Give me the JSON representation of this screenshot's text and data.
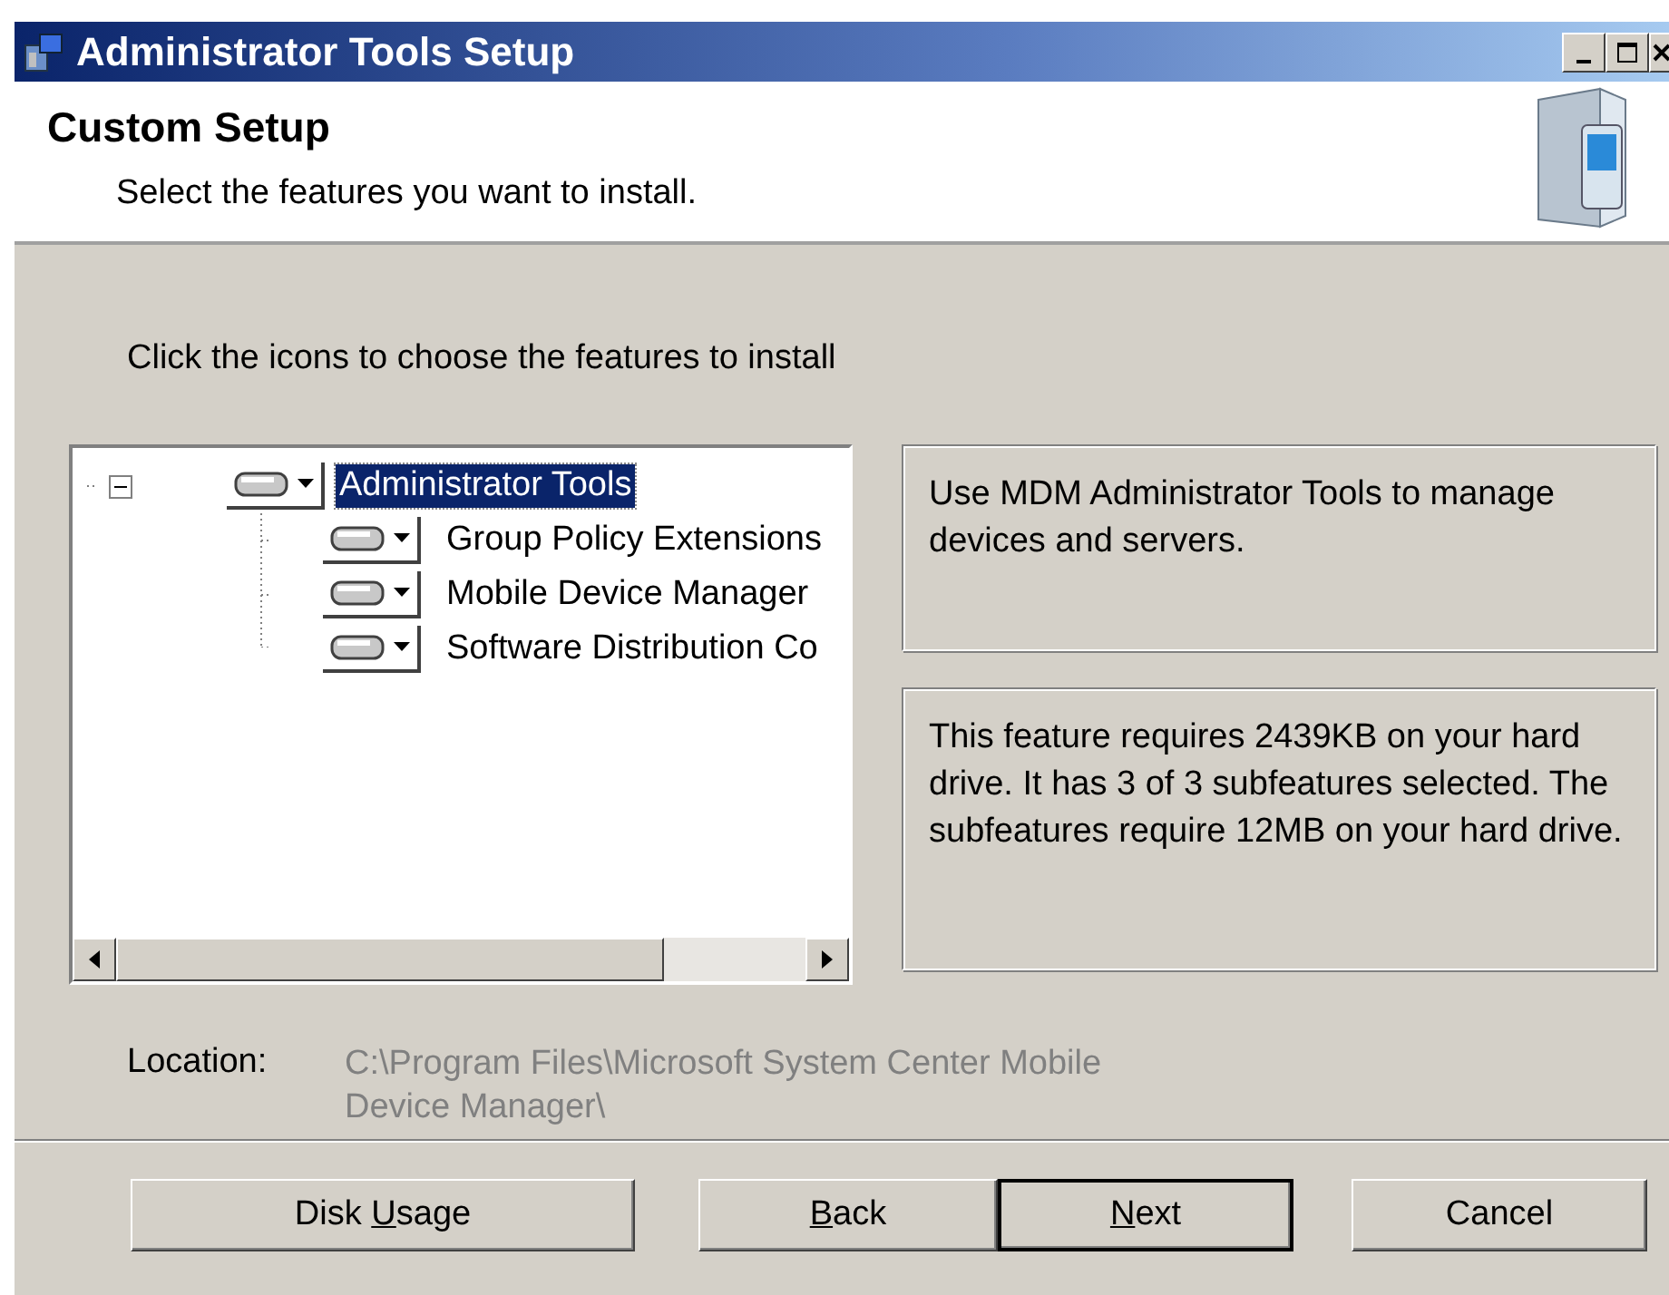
{
  "window": {
    "title": "Administrator Tools Setup"
  },
  "header": {
    "title": "Custom Setup",
    "subtitle": "Select the features you want to install."
  },
  "instruction": "Click the icons to choose the features to install",
  "tree": [
    {
      "label": "Administrator Tools",
      "selected": true,
      "expanded": true,
      "children": [
        {
          "label": "Group Policy Extensions",
          "selected": false
        },
        {
          "label": "Mobile Device Manager",
          "selected": false
        },
        {
          "label": "Software Distribution Co",
          "selected": false
        }
      ]
    }
  ],
  "description": "Use MDM Administrator Tools to manage devices and servers.",
  "requirements": "This feature requires 2439KB on your hard drive. It has 3 of 3 subfeatures selected. The subfeatures require 12MB on your hard drive.",
  "location": {
    "label": "Location:",
    "path": "C:\\Program Files\\Microsoft System Center Mobile Device Manager\\"
  },
  "buttons": [
    {
      "before": "Disk ",
      "key": "U",
      "after": "sage",
      "default": false
    },
    {
      "key": "B",
      "after": "ack",
      "default": false
    },
    {
      "key": "N",
      "after": "ext",
      "default": true
    },
    {
      "before": "Cancel",
      "default": false
    }
  ]
}
